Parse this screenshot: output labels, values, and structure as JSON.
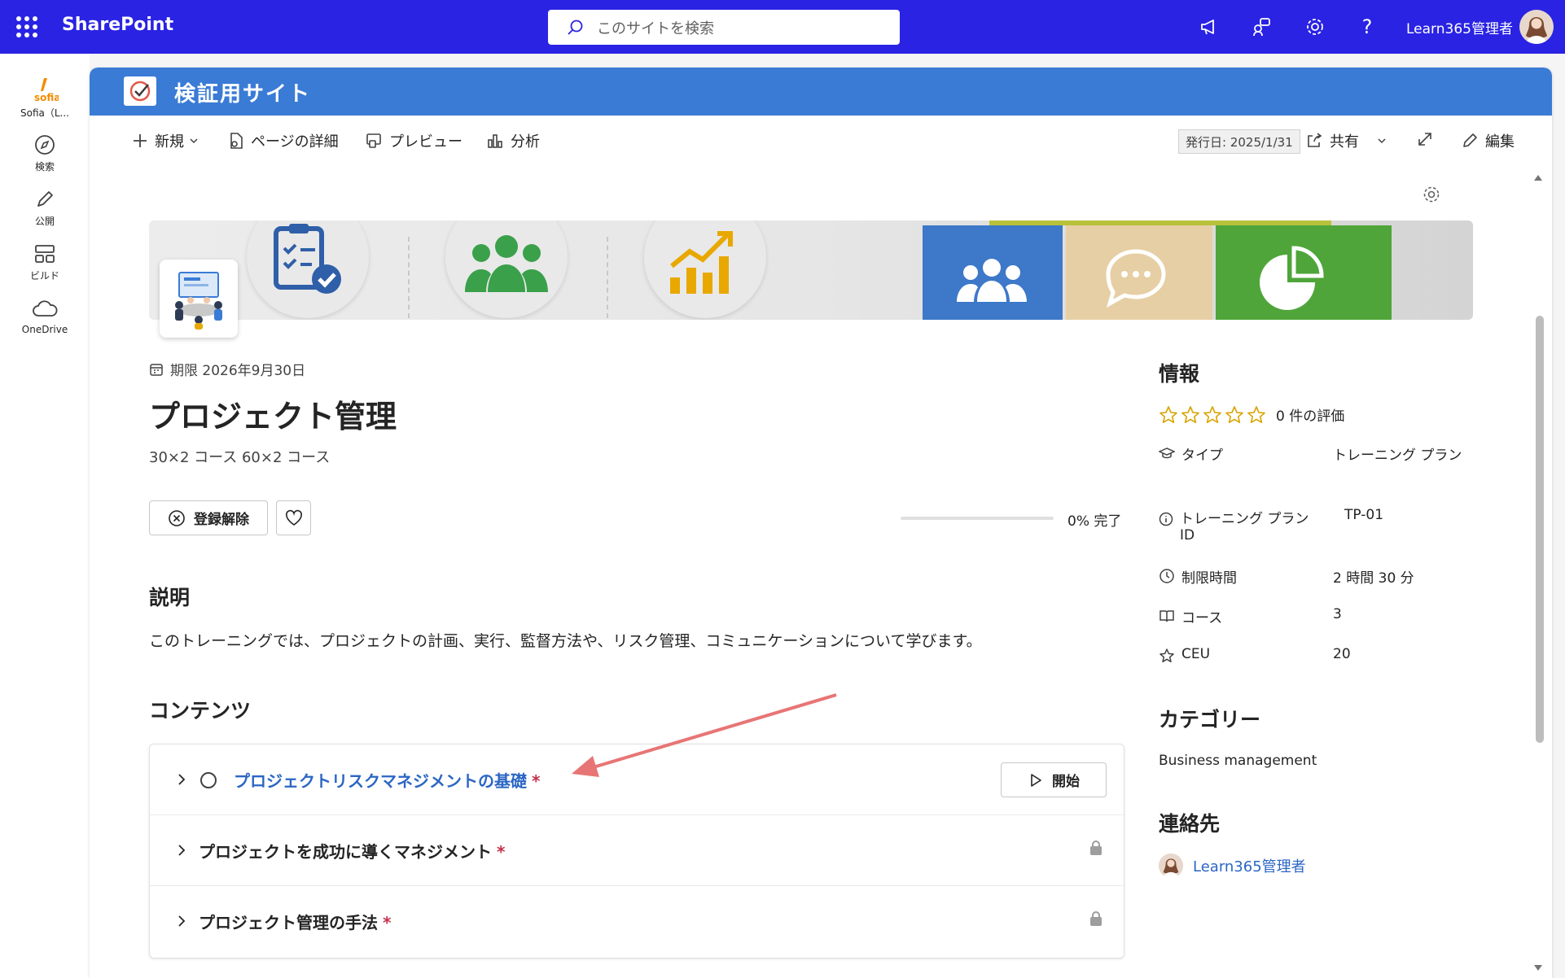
{
  "suitebar": {
    "app_name": "SharePoint",
    "search_placeholder": "このサイトを検索",
    "user_name": "Learn365管理者"
  },
  "leftrail": {
    "items": [
      {
        "label": "Sofia（L..."
      },
      {
        "label": "検索"
      },
      {
        "label": "公開"
      },
      {
        "label": "ビルド"
      },
      {
        "label": "OneDrive"
      }
    ]
  },
  "site": {
    "title": "検証用サイト"
  },
  "commandbar": {
    "new": "新規",
    "page_details": "ページの詳細",
    "preview": "プレビュー",
    "analytics": "分析",
    "published": "発行日: 2025/1/31",
    "share": "共有",
    "edit": "編集"
  },
  "training": {
    "due": "期限 2026年9月30日",
    "title": "プロジェクト管理",
    "subtitle": "30×2 コース 60×2 コース",
    "unenroll_label": "登録解除",
    "progress_percent": 0,
    "progress_label": "0% 完了"
  },
  "description": {
    "heading": "説明",
    "text": "このトレーニングでは、プロジェクトの計画、実行、監督方法や、リスク管理、コミュニケーションについて学びます。"
  },
  "contents": {
    "heading": "コンテンツ",
    "required_mark": "*",
    "start_label": "開始",
    "items": [
      {
        "title": "プロジェクトリスクマネジメントの基礎"
      },
      {
        "title": "プロジェクトを成功に導くマネジメント"
      },
      {
        "title": "プロジェクト管理の手法"
      }
    ]
  },
  "info": {
    "heading": "情報",
    "rating_label": "0 件の評価",
    "type_key": "タイプ",
    "type_value": "トレーニング プラン",
    "plan_id_key": "トレーニング プラン ID",
    "plan_id_value": "TP-01",
    "time_key": "制限時間",
    "time_value": "2 時間 30 分",
    "courses_key": "コース",
    "courses_value": "3",
    "ceu_key": "CEU",
    "ceu_value": "20"
  },
  "category": {
    "heading": "カテゴリー",
    "value": "Business management"
  },
  "contact": {
    "heading": "連絡先",
    "name": "Learn365管理者"
  },
  "colors": {
    "suitebar": "#2a23e3",
    "site_header": "#3a7bd5",
    "link": "#2b66c4",
    "required": "#c4314b",
    "rating_star": "#d9a400",
    "annotation_arrow": "#e87575"
  }
}
